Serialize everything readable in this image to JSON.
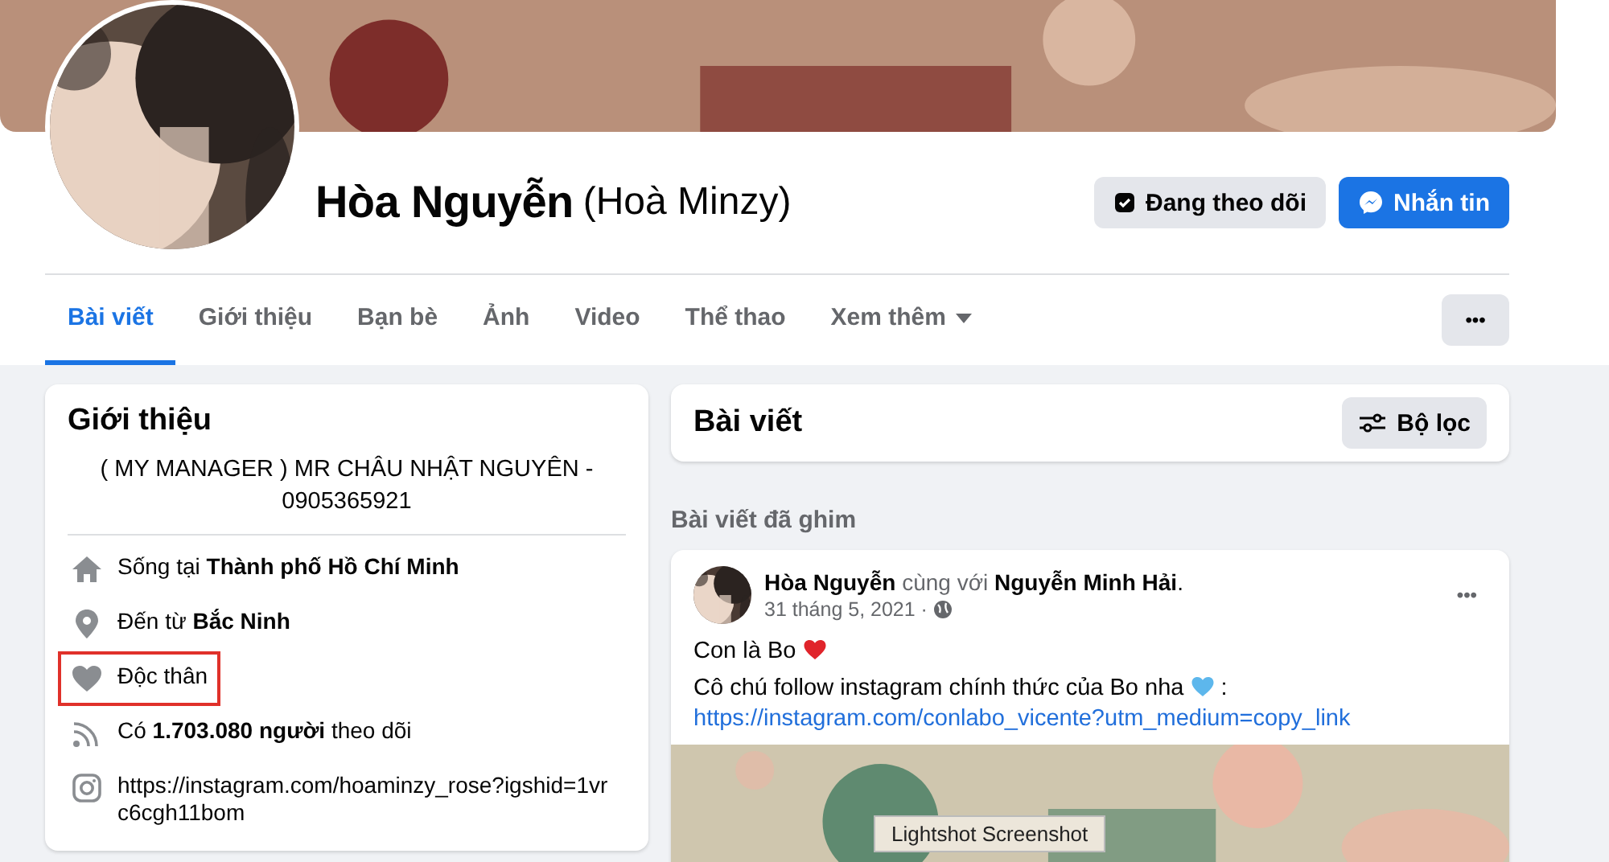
{
  "profile": {
    "name": "Hòa Nguyễn",
    "alt_name": "(Hoà Minzy)"
  },
  "actions": [
    {
      "label": "Đang theo dõi",
      "kind": "following"
    },
    {
      "label": "Nhắn tin",
      "kind": "message"
    }
  ],
  "tabs": [
    {
      "label": "Bài viết",
      "selected": true
    },
    {
      "label": "Giới thiệu",
      "selected": false
    },
    {
      "label": "Bạn bè",
      "selected": false
    },
    {
      "label": "Ảnh",
      "selected": false
    },
    {
      "label": "Video",
      "selected": false
    },
    {
      "label": "Thể thao",
      "selected": false
    },
    {
      "label": "Xem thêm",
      "selected": false,
      "dropdown": true
    }
  ],
  "more_button": "•••",
  "intro": {
    "title": "Giới thiệu",
    "bio": "( MY MANAGER ) MR CHÂU NHẬT NGUYÊN - 0905365921",
    "items": [
      {
        "kind": "home",
        "text": "Sống tại **Thành phố Hồ Chí Minh**",
        "highlighted": false
      },
      {
        "kind": "pin",
        "text": "Đến từ **Bắc Ninh**",
        "highlighted": false
      },
      {
        "kind": "heart",
        "text": "Độc thân",
        "highlighted": true
      },
      {
        "kind": "rss",
        "text": "Có **1.703.080 người** theo dõi",
        "highlighted": false
      },
      {
        "kind": "instagram",
        "text": "https://instagram.com/hoaminzy_rose?igshid=1vrc6cgh11bom",
        "highlighted": false
      }
    ]
  },
  "posts_header": {
    "title": "Bài viết",
    "filter": "Bộ lọc"
  },
  "pinned_label": "Bài viết đã ghim",
  "post": {
    "author": "Hòa Nguyễn",
    "with_text": "cùng với",
    "tagged": "Nguyễn Minh Hải",
    "tagged_tail": ".",
    "date": "31 tháng 5, 2021 ·",
    "menu": "•••",
    "line1": "Con là Bo",
    "line2": "Cô chú follow instagram chính thức của Bo nha",
    "line2_tail": ":",
    "link": "https://instagram.com/conlabo_vicente?utm_medium=copy_link"
  },
  "overlay_tooltip": "Lightshot Screenshot"
}
